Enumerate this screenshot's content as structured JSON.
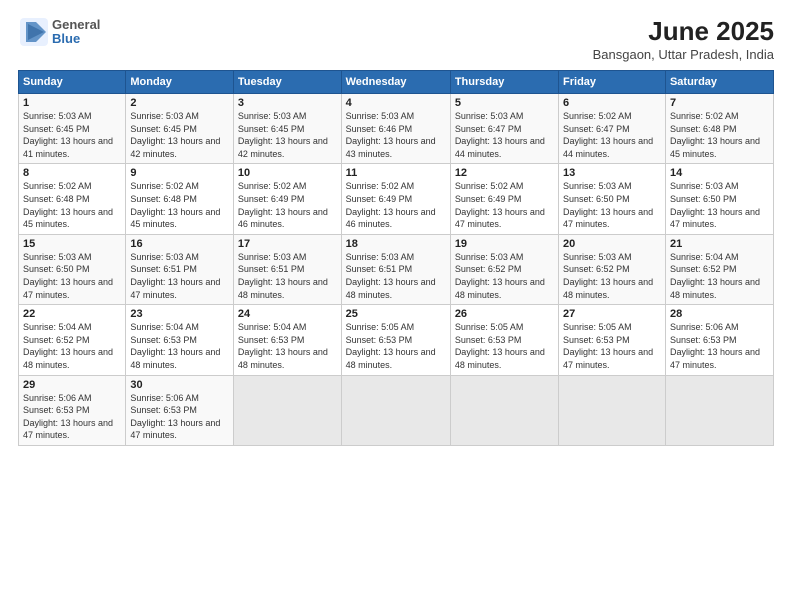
{
  "header": {
    "logo_line1": "General",
    "logo_line2": "Blue",
    "title": "June 2025",
    "subtitle": "Bansgaon, Uttar Pradesh, India"
  },
  "days_of_week": [
    "Sunday",
    "Monday",
    "Tuesday",
    "Wednesday",
    "Thursday",
    "Friday",
    "Saturday"
  ],
  "weeks": [
    [
      {
        "day": "1",
        "sunrise": "5:03 AM",
        "sunset": "6:45 PM",
        "daylight": "13 hours and 41 minutes."
      },
      {
        "day": "2",
        "sunrise": "5:03 AM",
        "sunset": "6:45 PM",
        "daylight": "13 hours and 42 minutes."
      },
      {
        "day": "3",
        "sunrise": "5:03 AM",
        "sunset": "6:45 PM",
        "daylight": "13 hours and 42 minutes."
      },
      {
        "day": "4",
        "sunrise": "5:03 AM",
        "sunset": "6:46 PM",
        "daylight": "13 hours and 43 minutes."
      },
      {
        "day": "5",
        "sunrise": "5:03 AM",
        "sunset": "6:47 PM",
        "daylight": "13 hours and 44 minutes."
      },
      {
        "day": "6",
        "sunrise": "5:02 AM",
        "sunset": "6:47 PM",
        "daylight": "13 hours and 44 minutes."
      },
      {
        "day": "7",
        "sunrise": "5:02 AM",
        "sunset": "6:48 PM",
        "daylight": "13 hours and 45 minutes."
      }
    ],
    [
      {
        "day": "8",
        "sunrise": "5:02 AM",
        "sunset": "6:48 PM",
        "daylight": "13 hours and 45 minutes."
      },
      {
        "day": "9",
        "sunrise": "5:02 AM",
        "sunset": "6:48 PM",
        "daylight": "13 hours and 45 minutes."
      },
      {
        "day": "10",
        "sunrise": "5:02 AM",
        "sunset": "6:49 PM",
        "daylight": "13 hours and 46 minutes."
      },
      {
        "day": "11",
        "sunrise": "5:02 AM",
        "sunset": "6:49 PM",
        "daylight": "13 hours and 46 minutes."
      },
      {
        "day": "12",
        "sunrise": "5:02 AM",
        "sunset": "6:49 PM",
        "daylight": "13 hours and 47 minutes."
      },
      {
        "day": "13",
        "sunrise": "5:03 AM",
        "sunset": "6:50 PM",
        "daylight": "13 hours and 47 minutes."
      },
      {
        "day": "14",
        "sunrise": "5:03 AM",
        "sunset": "6:50 PM",
        "daylight": "13 hours and 47 minutes."
      }
    ],
    [
      {
        "day": "15",
        "sunrise": "5:03 AM",
        "sunset": "6:50 PM",
        "daylight": "13 hours and 47 minutes."
      },
      {
        "day": "16",
        "sunrise": "5:03 AM",
        "sunset": "6:51 PM",
        "daylight": "13 hours and 47 minutes."
      },
      {
        "day": "17",
        "sunrise": "5:03 AM",
        "sunset": "6:51 PM",
        "daylight": "13 hours and 48 minutes."
      },
      {
        "day": "18",
        "sunrise": "5:03 AM",
        "sunset": "6:51 PM",
        "daylight": "13 hours and 48 minutes."
      },
      {
        "day": "19",
        "sunrise": "5:03 AM",
        "sunset": "6:52 PM",
        "daylight": "13 hours and 48 minutes."
      },
      {
        "day": "20",
        "sunrise": "5:03 AM",
        "sunset": "6:52 PM",
        "daylight": "13 hours and 48 minutes."
      },
      {
        "day": "21",
        "sunrise": "5:04 AM",
        "sunset": "6:52 PM",
        "daylight": "13 hours and 48 minutes."
      }
    ],
    [
      {
        "day": "22",
        "sunrise": "5:04 AM",
        "sunset": "6:52 PM",
        "daylight": "13 hours and 48 minutes."
      },
      {
        "day": "23",
        "sunrise": "5:04 AM",
        "sunset": "6:53 PM",
        "daylight": "13 hours and 48 minutes."
      },
      {
        "day": "24",
        "sunrise": "5:04 AM",
        "sunset": "6:53 PM",
        "daylight": "13 hours and 48 minutes."
      },
      {
        "day": "25",
        "sunrise": "5:05 AM",
        "sunset": "6:53 PM",
        "daylight": "13 hours and 48 minutes."
      },
      {
        "day": "26",
        "sunrise": "5:05 AM",
        "sunset": "6:53 PM",
        "daylight": "13 hours and 48 minutes."
      },
      {
        "day": "27",
        "sunrise": "5:05 AM",
        "sunset": "6:53 PM",
        "daylight": "13 hours and 47 minutes."
      },
      {
        "day": "28",
        "sunrise": "5:06 AM",
        "sunset": "6:53 PM",
        "daylight": "13 hours and 47 minutes."
      }
    ],
    [
      {
        "day": "29",
        "sunrise": "5:06 AM",
        "sunset": "6:53 PM",
        "daylight": "13 hours and 47 minutes."
      },
      {
        "day": "30",
        "sunrise": "5:06 AM",
        "sunset": "6:53 PM",
        "daylight": "13 hours and 47 minutes."
      },
      null,
      null,
      null,
      null,
      null
    ]
  ]
}
